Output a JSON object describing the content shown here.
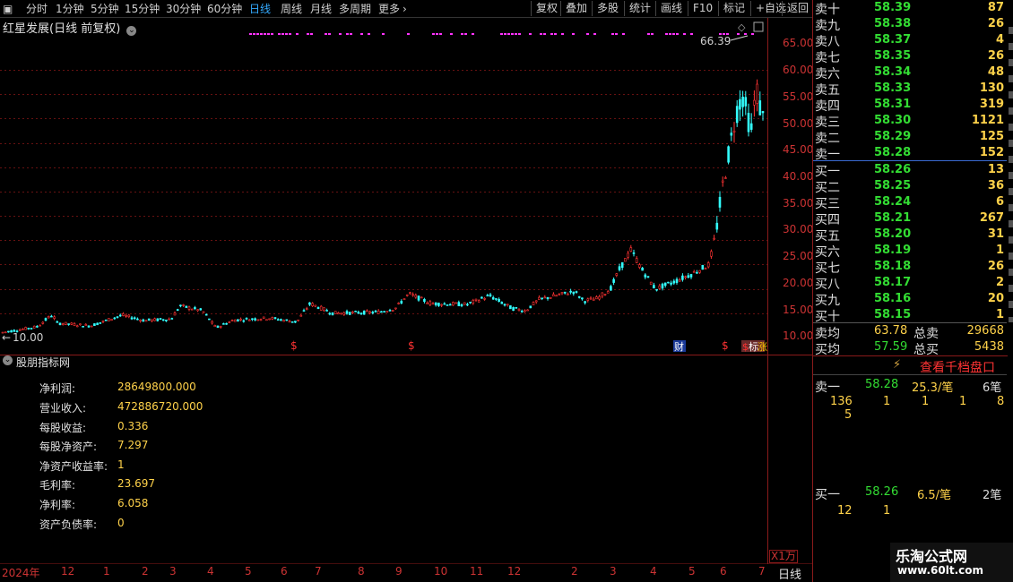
{
  "toolbar": {
    "tabs": [
      "分时",
      "1分钟",
      "5分钟",
      "15分钟",
      "30分钟",
      "60分钟",
      "日线",
      "周线",
      "月线",
      "多周期",
      "更多"
    ],
    "active_tab": "日线",
    "buttons": [
      "复权",
      "叠加",
      "多股",
      "统计",
      "画线",
      "F10",
      "标记",
      "+自选",
      "返回"
    ]
  },
  "chart": {
    "title": "红星发展(日线 前复权)",
    "high_label": "66.39",
    "low_label": "10.00",
    "y_ticks": [
      "65.00",
      "60.00",
      "55.00",
      "50.00",
      "45.00",
      "40.00",
      "35.00",
      "30.00",
      "25.00",
      "20.00",
      "15.00",
      "10.00"
    ],
    "markers": [
      "$",
      "$",
      "财",
      "$",
      "$",
      "标",
      "涨"
    ],
    "unit_label": "X1万",
    "colors": {
      "up": "#ff3333",
      "down": "#33ffff",
      "grid": "#661111",
      "magenta": "#ff33ff"
    }
  },
  "indicator": {
    "title": "股朋指标网",
    "rows": [
      {
        "label": "净利润:",
        "value": "28649800.000"
      },
      {
        "label": "营业收入:",
        "value": "472886720.000"
      },
      {
        "label": "每股收益:",
        "value": "0.336"
      },
      {
        "label": "每股净资产:",
        "value": "7.297"
      },
      {
        "label": "净资产收益率:",
        "value": "1"
      },
      {
        "label": "毛利率:",
        "value": "23.697"
      },
      {
        "label": "净利率:",
        "value": "6.058"
      },
      {
        "label": "资产负债率:",
        "value": "0"
      }
    ]
  },
  "date_axis": {
    "labels": [
      "2024年",
      "12",
      "1",
      "2",
      "3",
      "4",
      "5",
      "6",
      "7",
      "8",
      "9",
      "10",
      "11",
      "12",
      "2",
      "3",
      "4",
      "5",
      "6",
      "7"
    ],
    "period_label": "日线"
  },
  "order_book": {
    "sells": [
      {
        "label": "卖十",
        "price": "58.39",
        "vol": "87"
      },
      {
        "label": "卖九",
        "price": "58.38",
        "vol": "26"
      },
      {
        "label": "卖八",
        "price": "58.37",
        "vol": "4"
      },
      {
        "label": "卖七",
        "price": "58.35",
        "vol": "26"
      },
      {
        "label": "卖六",
        "price": "58.34",
        "vol": "48"
      },
      {
        "label": "卖五",
        "price": "58.33",
        "vol": "130"
      },
      {
        "label": "卖四",
        "price": "58.31",
        "vol": "319"
      },
      {
        "label": "卖三",
        "price": "58.30",
        "vol": "1121"
      },
      {
        "label": "卖二",
        "price": "58.29",
        "vol": "125"
      },
      {
        "label": "卖一",
        "price": "58.28",
        "vol": "152"
      }
    ],
    "buys": [
      {
        "label": "买一",
        "price": "58.26",
        "vol": "13"
      },
      {
        "label": "买二",
        "price": "58.25",
        "vol": "36"
      },
      {
        "label": "买三",
        "price": "58.24",
        "vol": "6"
      },
      {
        "label": "买四",
        "price": "58.21",
        "vol": "267"
      },
      {
        "label": "买五",
        "price": "58.20",
        "vol": "31"
      },
      {
        "label": "买六",
        "price": "58.19",
        "vol": "1"
      },
      {
        "label": "买七",
        "price": "58.18",
        "vol": "26"
      },
      {
        "label": "买八",
        "price": "58.17",
        "vol": "2"
      },
      {
        "label": "买九",
        "price": "58.16",
        "vol": "20"
      },
      {
        "label": "买十",
        "price": "58.15",
        "vol": "1"
      }
    ],
    "sell_avg_label": "卖均",
    "sell_avg": "63.78",
    "total_sell_label": "总卖",
    "total_sell": "29668",
    "buy_avg_label": "买均",
    "buy_avg": "57.59",
    "total_buy_label": "总买",
    "total_buy": "5438"
  },
  "detail_panel": {
    "button": "查看千档盘口",
    "sell1_label": "卖一",
    "sell1_price": "58.28",
    "sell1_avg": "25.3/笔",
    "sell1_count": "6笔",
    "sell1_orders": [
      "136",
      "1",
      "1",
      "1",
      "8"
    ],
    "sell1_orders_wrap": "5",
    "buy1_label": "买一",
    "buy1_price": "58.26",
    "buy1_avg": "6.5/笔",
    "buy1_count": "2笔",
    "buy1_orders": [
      "12",
      "1"
    ]
  },
  "watermark": {
    "title": "乐淘公式网",
    "url": "www.60lt.com"
  }
}
